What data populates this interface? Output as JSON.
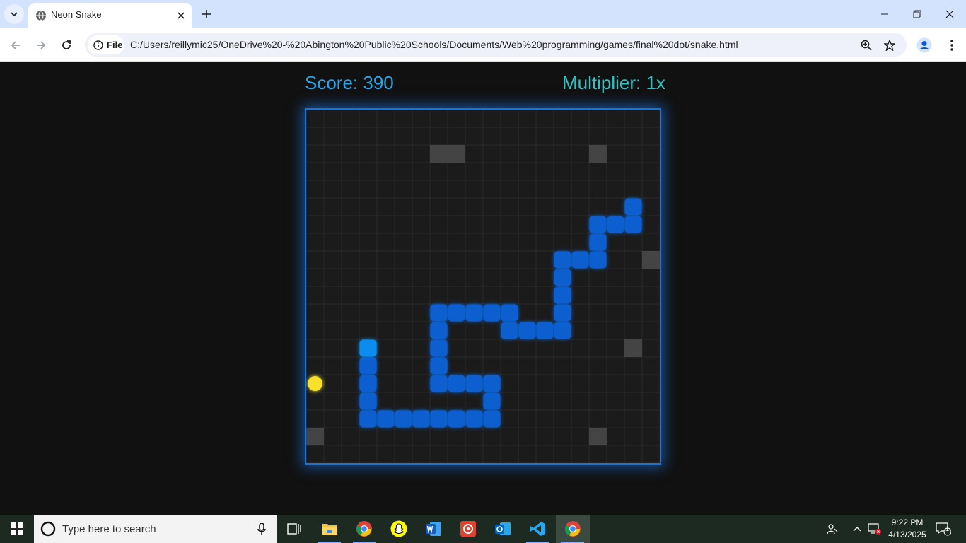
{
  "browser": {
    "tab_title": "Neon Snake",
    "site_chip": "File",
    "url": "C:/Users/reillymic25/OneDrive%20-%20Abington%20Public%20Schools/Documents/Web%20programming/games/final%20dot/snake.html"
  },
  "game": {
    "score_text": "Score: 390",
    "multiplier_text": "Multiplier: 1x",
    "grid_cols": 20,
    "grid_rows": 20,
    "colors": {
      "background": "#111111",
      "board": "#1b1b1b",
      "grid_line": "#2a2a2a",
      "border": "#1874d6",
      "snake": "#0a5fd0",
      "snake_head": "#0a8cf0",
      "food": "#f7e12b",
      "obstacle": "#444444",
      "score": "#29a3e8",
      "multiplier": "#2ec4c4"
    },
    "snake_head": [
      3,
      13
    ],
    "snake_body": [
      [
        3,
        14
      ],
      [
        3,
        15
      ],
      [
        3,
        16
      ],
      [
        3,
        17
      ],
      [
        4,
        17
      ],
      [
        5,
        17
      ],
      [
        6,
        17
      ],
      [
        7,
        17
      ],
      [
        8,
        17
      ],
      [
        9,
        17
      ],
      [
        10,
        17
      ],
      [
        10,
        16
      ],
      [
        10,
        15
      ],
      [
        9,
        15
      ],
      [
        8,
        15
      ],
      [
        7,
        15
      ],
      [
        7,
        14
      ],
      [
        7,
        13
      ],
      [
        7,
        12
      ],
      [
        7,
        11
      ],
      [
        8,
        11
      ],
      [
        9,
        11
      ],
      [
        10,
        11
      ],
      [
        11,
        11
      ],
      [
        11,
        12
      ],
      [
        12,
        12
      ],
      [
        13,
        12
      ],
      [
        14,
        12
      ],
      [
        14,
        11
      ],
      [
        14,
        10
      ],
      [
        14,
        9
      ],
      [
        14,
        8
      ],
      [
        15,
        8
      ],
      [
        16,
        8
      ],
      [
        16,
        7
      ],
      [
        16,
        6
      ],
      [
        17,
        6
      ],
      [
        18,
        6
      ],
      [
        18,
        5
      ]
    ],
    "food": [
      0,
      15
    ],
    "obstacles": [
      [
        7,
        2
      ],
      [
        8,
        2
      ],
      [
        16,
        2
      ],
      [
        19,
        8
      ],
      [
        18,
        13
      ],
      [
        0,
        18
      ],
      [
        16,
        18
      ]
    ]
  },
  "taskbar": {
    "search_placeholder": "Type here to search",
    "time": "9:22 PM",
    "date": "4/13/2025",
    "notification_count": "1"
  }
}
